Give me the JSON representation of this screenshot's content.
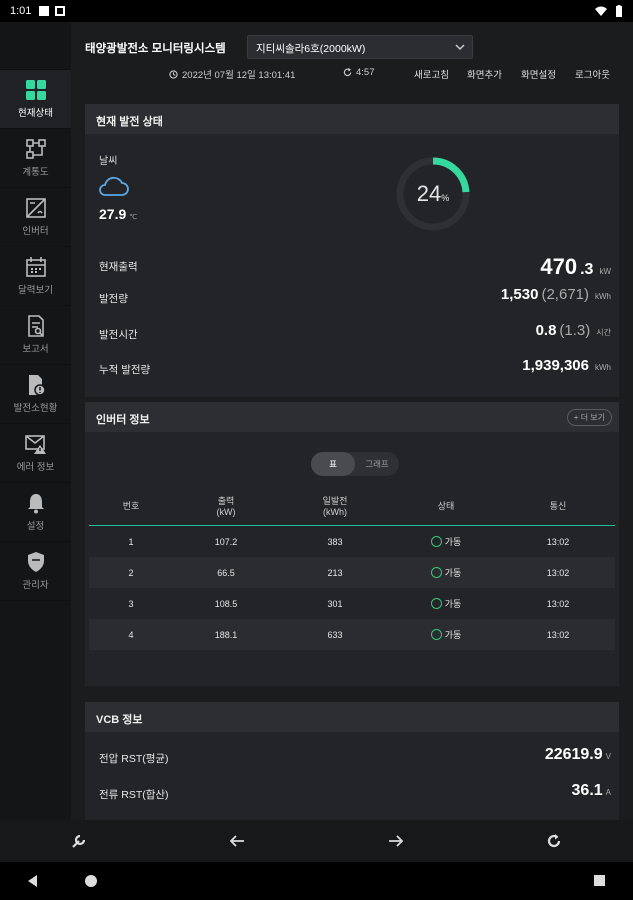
{
  "status_bar": {
    "time": "1:01"
  },
  "header": {
    "title": "태양광발전소 모니터링시스템",
    "site": "지티씨솔라6호(2000kW)",
    "datetime": "2022년 07월 12일 13:01:41",
    "timer": "4:57",
    "buttons": [
      "새로고침",
      "화면추가",
      "화면설정",
      "로그아웃"
    ]
  },
  "sidebar": {
    "items": [
      {
        "label": "현재상태",
        "icon": "grid-icon"
      },
      {
        "label": "계통도",
        "icon": "diagram-icon"
      },
      {
        "label": "인버터",
        "icon": "inverter-icon"
      },
      {
        "label": "달력보기",
        "icon": "calendar-icon"
      },
      {
        "label": "보고서",
        "icon": "report-icon"
      },
      {
        "label": "발전소현황",
        "icon": "plant-status-icon"
      },
      {
        "label": "에러 정보",
        "icon": "error-mail-icon"
      },
      {
        "label": "설정",
        "icon": "bell-icon"
      },
      {
        "label": "관리자",
        "icon": "shield-icon"
      }
    ]
  },
  "generation": {
    "title": "현재 발전 상태",
    "weather_label": "날씨",
    "temperature": "27.9",
    "temp_unit": "℃",
    "percent": "24",
    "percent_unit": "%",
    "percent_value": 24,
    "rows": [
      {
        "label": "현재출력",
        "value": "470",
        "decimal": ".3",
        "unit": "kW"
      },
      {
        "label": "발전량",
        "value": "1,530",
        "sub": "(2,671)",
        "unit": "kWh"
      },
      {
        "label": "발전시간",
        "value": "0.8",
        "sub": "(1.3)",
        "unit": "시간"
      },
      {
        "label": "누적 발전량",
        "value": "1,939,306",
        "unit": "kWh"
      }
    ]
  },
  "inverter": {
    "title": "인버터 정보",
    "more": "+ 더 보기",
    "tabs": [
      "표",
      "그래프"
    ],
    "columns": [
      "번호",
      "출력\n(kW)",
      "일발전\n(kWh)",
      "상태",
      "통신"
    ],
    "col_lines": [
      [
        "번호"
      ],
      [
        "출력",
        "(kW)"
      ],
      [
        "일발전",
        "(kWh)"
      ],
      [
        "상태"
      ],
      [
        "통신"
      ]
    ],
    "rows": [
      {
        "no": "1",
        "output": "107.2",
        "daily": "383",
        "status": "가동",
        "comm": "13:02"
      },
      {
        "no": "2",
        "output": "66.5",
        "daily": "213",
        "status": "가동",
        "comm": "13:02"
      },
      {
        "no": "3",
        "output": "108.5",
        "daily": "301",
        "status": "가동",
        "comm": "13:02"
      },
      {
        "no": "4",
        "output": "188.1",
        "daily": "633",
        "status": "가동",
        "comm": "13:02"
      }
    ]
  },
  "vcb": {
    "title": "VCB 정보",
    "rows": [
      {
        "label": "전압 RST(평균)",
        "value": "22619.9",
        "unit": "V"
      },
      {
        "label": "전류 RST(합산)",
        "value": "36.1",
        "unit": "A"
      }
    ]
  },
  "colors": {
    "accent": "#35d9a0",
    "status_ok": "#35c77d",
    "background": "#1b1c1e"
  }
}
